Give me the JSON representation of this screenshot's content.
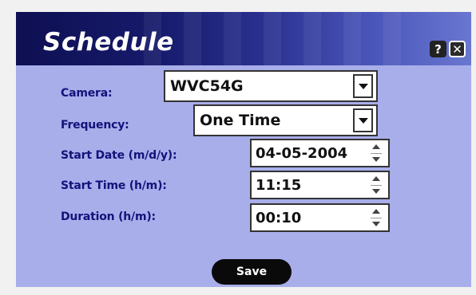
{
  "window": {
    "title": "Schedule",
    "help_label": "?",
    "close_label": "✕"
  },
  "fields": {
    "camera": {
      "label": "Camera:",
      "value": "WVC54G"
    },
    "frequency": {
      "label": "Frequency:",
      "value": "One Time"
    },
    "start_date": {
      "label": "Start Date (m/d/y):",
      "value": "04-05-2004"
    },
    "start_time": {
      "label": "Start Time (h/m):",
      "value": "11:15"
    },
    "duration": {
      "label": "Duration (h/m):",
      "value": "00:10"
    }
  },
  "actions": {
    "save_label": "Save"
  },
  "colors": {
    "title_bar_dark": "#0e0f52",
    "panel": "#a8aeea",
    "label_text": "#12137a"
  }
}
